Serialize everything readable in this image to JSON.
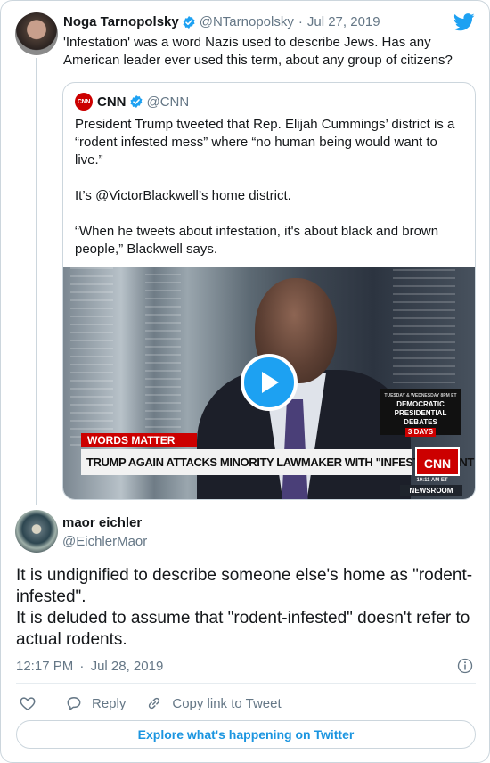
{
  "original_tweet": {
    "author_name": "Noga Tarnopolsky",
    "handle": "@NTarnopolsky",
    "separator": "·",
    "date": "Jul 27, 2019",
    "text": "'Infestation' was a word Nazis used to describe Jews. Has any American leader ever used this term, about any group of citizens?"
  },
  "quoted_tweet": {
    "logo_text": "CNN",
    "author_name": "CNN",
    "handle": "@CNN",
    "paragraphs": [
      "President Trump tweeted that Rep. Elijah Cummings’ district is a “rodent infested mess” where “no human being would want to live.”",
      "It’s @VictorBlackwell’s home district.",
      "“When he tweets about infestation, it's about black and brown people,” Blackwell says."
    ],
    "video": {
      "banner_label": "WORDS MATTER",
      "headline": "TRUMP AGAIN ATTACKS MINORITY LAWMAKER WITH \"INFESTED\" RANT",
      "network_bug": "CNN",
      "time": "10:11 AM ET",
      "show": "NEWSROOM",
      "promo": {
        "dates": "TUESDAY & WEDNESDAY 8PM ET",
        "line1": "DEMOCRATIC",
        "line2": "PRESIDENTIAL DEBATES",
        "days": "3 DAYS"
      }
    }
  },
  "reply": {
    "author_name": "maor eichler",
    "handle": "@EichlerMaor",
    "paragraphs": [
      "It is undignified to describe someone else's home as \"rodent-infested\".",
      "It is deluded to assume that \"rodent-infested\" doesn't refer to actual rodents."
    ],
    "time": "12:17 PM",
    "separator": "·",
    "date": "Jul 28, 2019"
  },
  "actions": {
    "reply_label": "Reply",
    "copy_label": "Copy link to Tweet"
  },
  "explore_label": "Explore what's happening on Twitter",
  "colors": {
    "twitter_blue": "#1da1f2",
    "link_blue": "#1b95e0",
    "muted": "#657786",
    "border": "#ccd6dd",
    "cnn_red": "#cc0000"
  },
  "icons": [
    "verified-badge-icon",
    "twitter-bird-icon",
    "play-icon",
    "info-icon",
    "heart-icon",
    "reply-icon",
    "link-icon"
  ]
}
